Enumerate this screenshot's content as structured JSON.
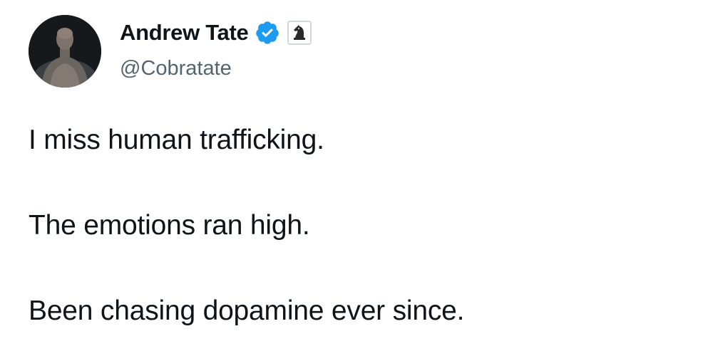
{
  "author": {
    "display_name": "Andrew Tate",
    "handle": "@Cobratate",
    "verified_icon": "verified-badge-icon",
    "affiliate_icon": "chess-knight-icon",
    "accent_color": "#1d9bf0"
  },
  "tweet": {
    "lines": [
      "I miss human trafficking.",
      "The emotions ran high.",
      "Been chasing dopamine ever since."
    ]
  }
}
